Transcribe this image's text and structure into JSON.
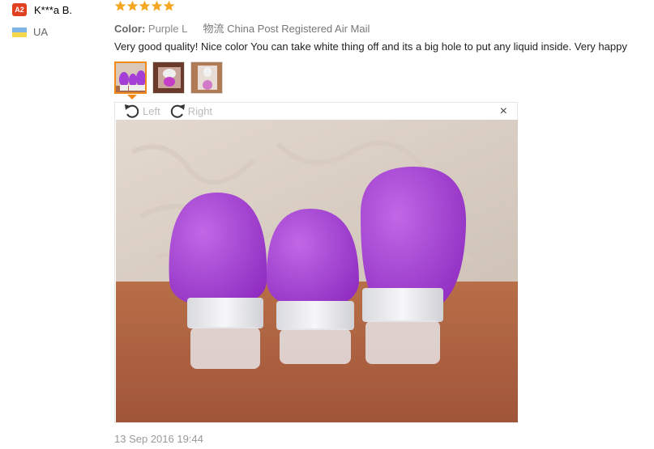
{
  "user": {
    "badge": "A2",
    "name": "K***a B.",
    "country": "UA"
  },
  "review": {
    "rating": 5,
    "color_label": "Color:",
    "color_value": "Purple L",
    "logistics": "物流 China Post Registered Air Mail",
    "text": "Very good quality! Nice color You can take white thing off and its a big hole to put any liquid inside. Very happy",
    "date": "13 Sep 2016 19:44"
  },
  "viewer": {
    "rotate_left": "Left",
    "rotate_right": "Right",
    "close": "×"
  },
  "colors": {
    "star": "#f5a623",
    "accent": "#f08a18",
    "bottle": "#a43ed6"
  },
  "icons": [
    "star-icon",
    "rotate-left-icon",
    "rotate-right-icon",
    "close-icon",
    "flag-icon"
  ]
}
